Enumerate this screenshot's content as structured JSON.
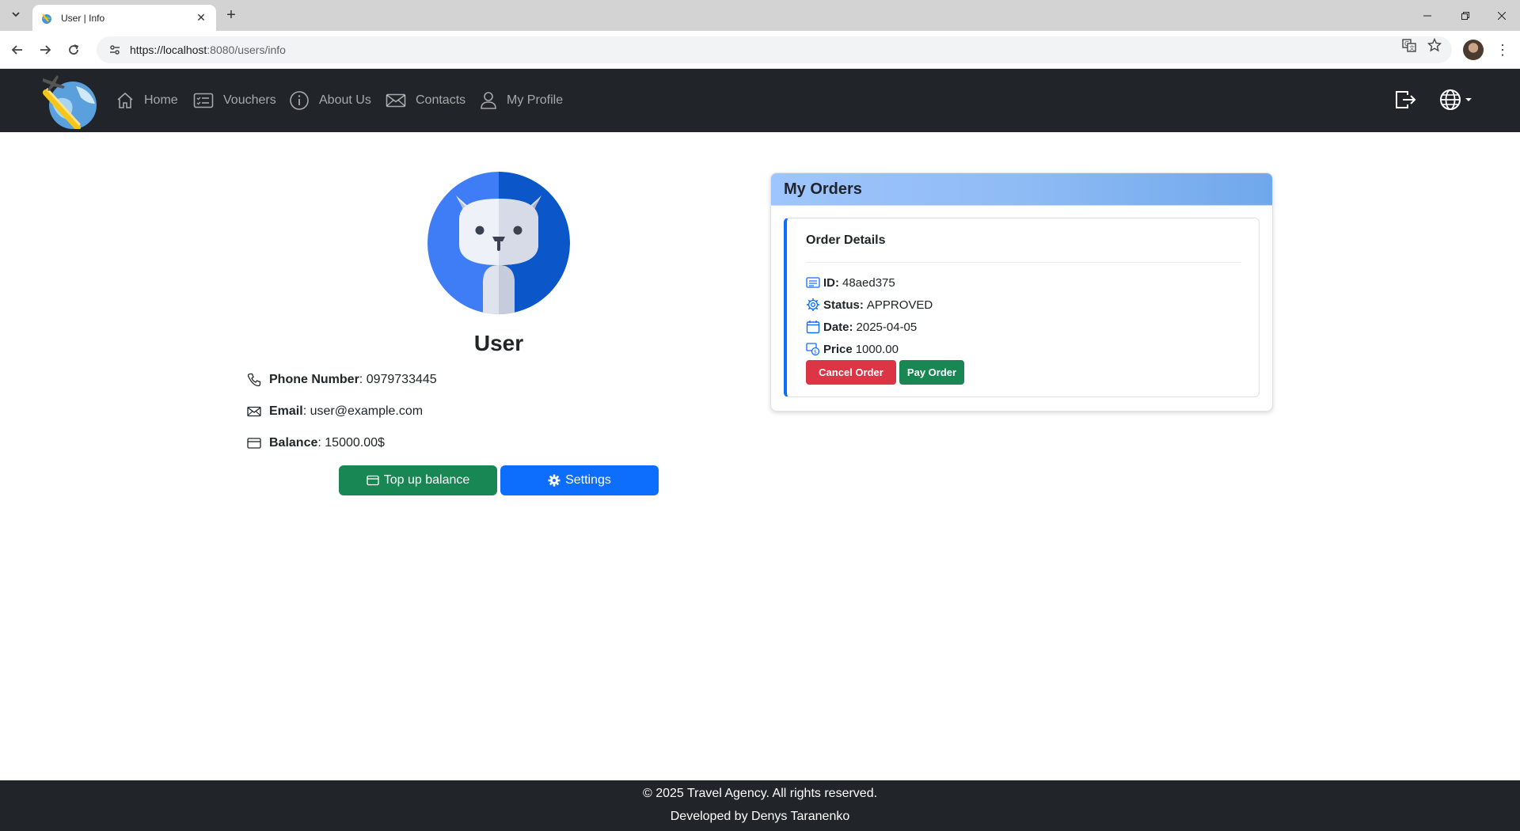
{
  "browser": {
    "tab_title": "User | Info",
    "url_host": "https://localhost",
    "url_rest": ":8080/users/info"
  },
  "navbar": {
    "items": [
      {
        "label": "Home",
        "icon": "house-icon"
      },
      {
        "label": "Vouchers",
        "icon": "card-list-icon"
      },
      {
        "label": "About Us",
        "icon": "info-circle-icon"
      },
      {
        "label": "Contacts",
        "icon": "envelope-icon"
      },
      {
        "label": "My Profile",
        "icon": "person-icon"
      }
    ],
    "right_icons": [
      "logout-icon",
      "globe-icon"
    ]
  },
  "profile": {
    "name": "User",
    "phone_label": "Phone Number",
    "phone": ": 0979733445",
    "email_label": "Email",
    "email": ": user@example.com",
    "balance_label": "Balance",
    "balance": ": 15000.00$",
    "topup_label": "Top up balance",
    "settings_label": "Settings"
  },
  "orders": {
    "title": "My Orders",
    "items": [
      {
        "details_title": "Order Details",
        "id_label": "ID:",
        "id": "48aed375",
        "status_label": "Status:",
        "status": "APPROVED",
        "date_label": "Date:",
        "date": "2025-04-05",
        "price_label": "Price",
        "price": "1000.00",
        "cancel_label": "Cancel Order",
        "pay_label": "Pay Order"
      }
    ]
  },
  "footer": {
    "copyright": "© 2025 Travel Agency. All rights reserved.",
    "developer": "Developed by Denys Taranenko"
  },
  "colors": {
    "navbar_bg": "#212529",
    "primary": "#0d6efd",
    "success": "#198754",
    "danger": "#dc3545"
  }
}
